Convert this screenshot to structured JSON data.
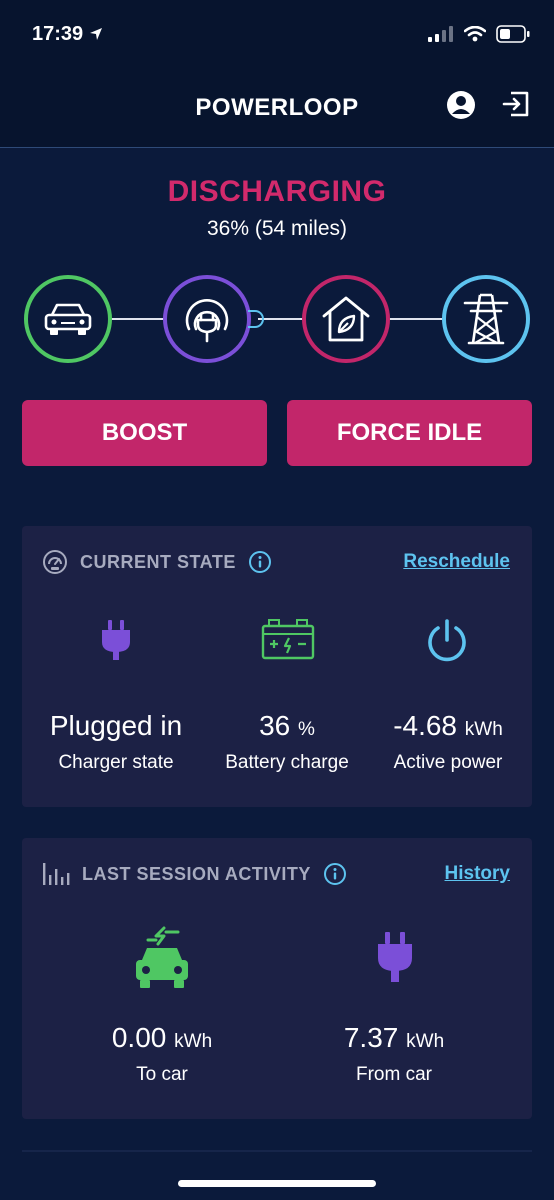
{
  "status_bar": {
    "time": "17:39"
  },
  "header": {
    "title": "POWERLOOP",
    "profile_icon": "user-circle-icon",
    "logout_icon": "exit-icon"
  },
  "status": {
    "mode": "DISCHARGING",
    "charge_info": "36% (54 miles)"
  },
  "flow_nodes": [
    {
      "icon": "car-icon",
      "color": "#4fc763"
    },
    {
      "icon": "charger-icon",
      "color": "#7b4fd8"
    },
    {
      "icon": "home-leaf-icon",
      "color": "#c2266a"
    },
    {
      "icon": "pylon-icon",
      "color": "#5dc3ef"
    }
  ],
  "actions": {
    "boost": "BOOST",
    "force_idle": "FORCE IDLE"
  },
  "current_state": {
    "title": "CURRENT STATE",
    "link": "Reschedule",
    "charger": {
      "value": "Plugged in",
      "label": "Charger state"
    },
    "battery": {
      "value": "36",
      "unit": "%",
      "label": "Battery charge"
    },
    "power": {
      "value": "-4.68",
      "unit": "kWh",
      "label": "Active power"
    }
  },
  "last_session": {
    "title": "LAST SESSION ACTIVITY",
    "link": "History",
    "to_car": {
      "value": "0.00",
      "unit": "kWh",
      "label": "To car"
    },
    "from_car": {
      "value": "7.37",
      "unit": "kWh",
      "label": "From car"
    }
  },
  "colors": {
    "accent_pink": "#c2266a",
    "green": "#4fc763",
    "purple": "#7b4fd8",
    "blue": "#5dc3ef",
    "background": "#0b1a3b",
    "card": "#1c2145"
  }
}
